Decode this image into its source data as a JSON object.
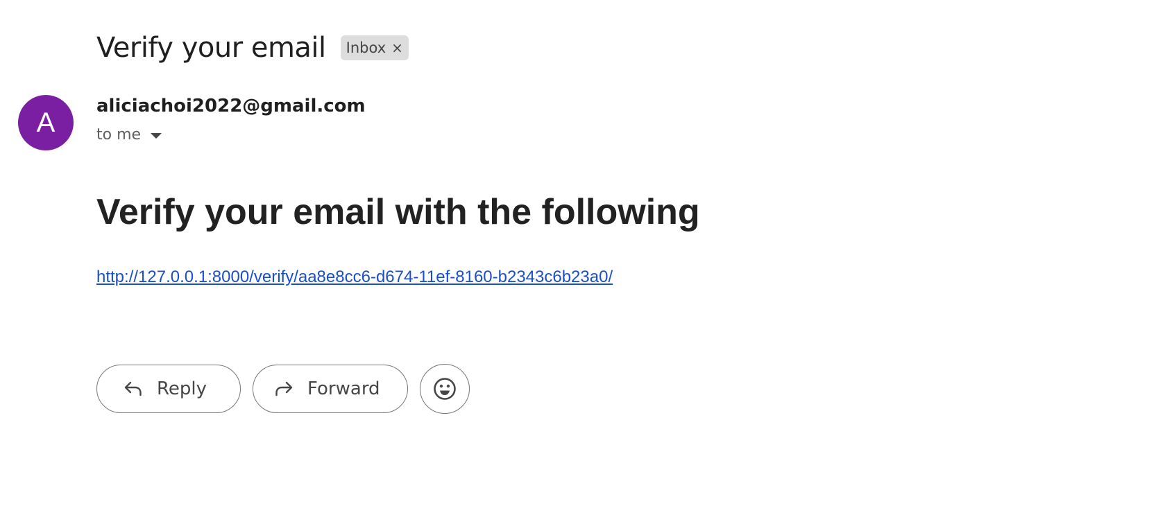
{
  "message": {
    "subject": "Verify your email",
    "labels": [
      {
        "name": "Inbox",
        "remove_glyph": "×"
      }
    ],
    "sender": {
      "avatar_letter": "A",
      "avatar_color": "#7b1fa2",
      "email": "aliciachoi2022@gmail.com"
    },
    "recipients_text": "to me",
    "body": {
      "heading": "Verify your email with the following",
      "link": "http://127.0.0.1:8000/verify/aa8e8cc6-d674-11ef-8160-b2343c6b23a0/"
    }
  },
  "actions": {
    "reply_label": "Reply",
    "forward_label": "Forward",
    "reply_icon": "reply-icon",
    "forward_icon": "forward-icon",
    "emoji_icon": "emoji-icon"
  },
  "colors": {
    "link": "#1a4fc9",
    "chip_bg": "#dddddd",
    "button_border": "#747775"
  }
}
